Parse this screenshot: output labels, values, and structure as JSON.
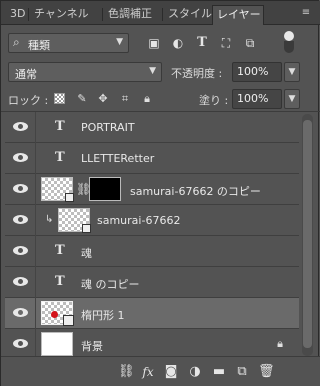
{
  "tabs": [
    {
      "label": "3D"
    },
    {
      "label": "チャンネル"
    },
    {
      "label": "色調補正"
    },
    {
      "label": "スタイル"
    },
    {
      "label": "レイヤー"
    }
  ],
  "active_tab": "レイヤー",
  "filter": {
    "kind_label": "種類"
  },
  "blend_mode": {
    "value": "通常"
  },
  "opacity": {
    "label": "不透明度 :",
    "value": "100%"
  },
  "lock": {
    "label": "ロック :"
  },
  "fill": {
    "label": "塗り :",
    "value": "100%"
  },
  "layers": [
    {
      "name": "PORTRAIT",
      "kind": "text",
      "visible": true
    },
    {
      "name": "LLETTERetter",
      "kind": "text",
      "visible": true
    },
    {
      "name": "samurai-67662 のコピー",
      "kind": "smart-object-with-mask",
      "visible": true
    },
    {
      "name": "samurai-67662",
      "kind": "smart-object-clipped",
      "visible": true
    },
    {
      "name": "魂",
      "kind": "text",
      "visible": true
    },
    {
      "name": "魂 のコピー",
      "kind": "text",
      "visible": true
    },
    {
      "name": "楕円形 1",
      "kind": "shape",
      "visible": true,
      "selected": true
    },
    {
      "name": "背景",
      "kind": "background",
      "visible": true,
      "locked": true
    }
  ],
  "icons": {
    "filter": [
      "pixel-layer-filter-icon",
      "adjustment-layer-filter-icon",
      "type-layer-filter-icon",
      "shape-layer-filter-icon",
      "smart-object-filter-icon"
    ],
    "lock": [
      "lock-transparent-pixels-icon",
      "lock-image-pixels-icon",
      "lock-position-icon",
      "lock-artboard-icon",
      "lock-all-icon"
    ],
    "bottom": [
      "link-layers-icon",
      "add-layer-style-icon",
      "add-layer-mask-icon",
      "new-fill-adjustment-icon",
      "new-group-icon",
      "new-layer-icon",
      "delete-layer-icon"
    ]
  }
}
